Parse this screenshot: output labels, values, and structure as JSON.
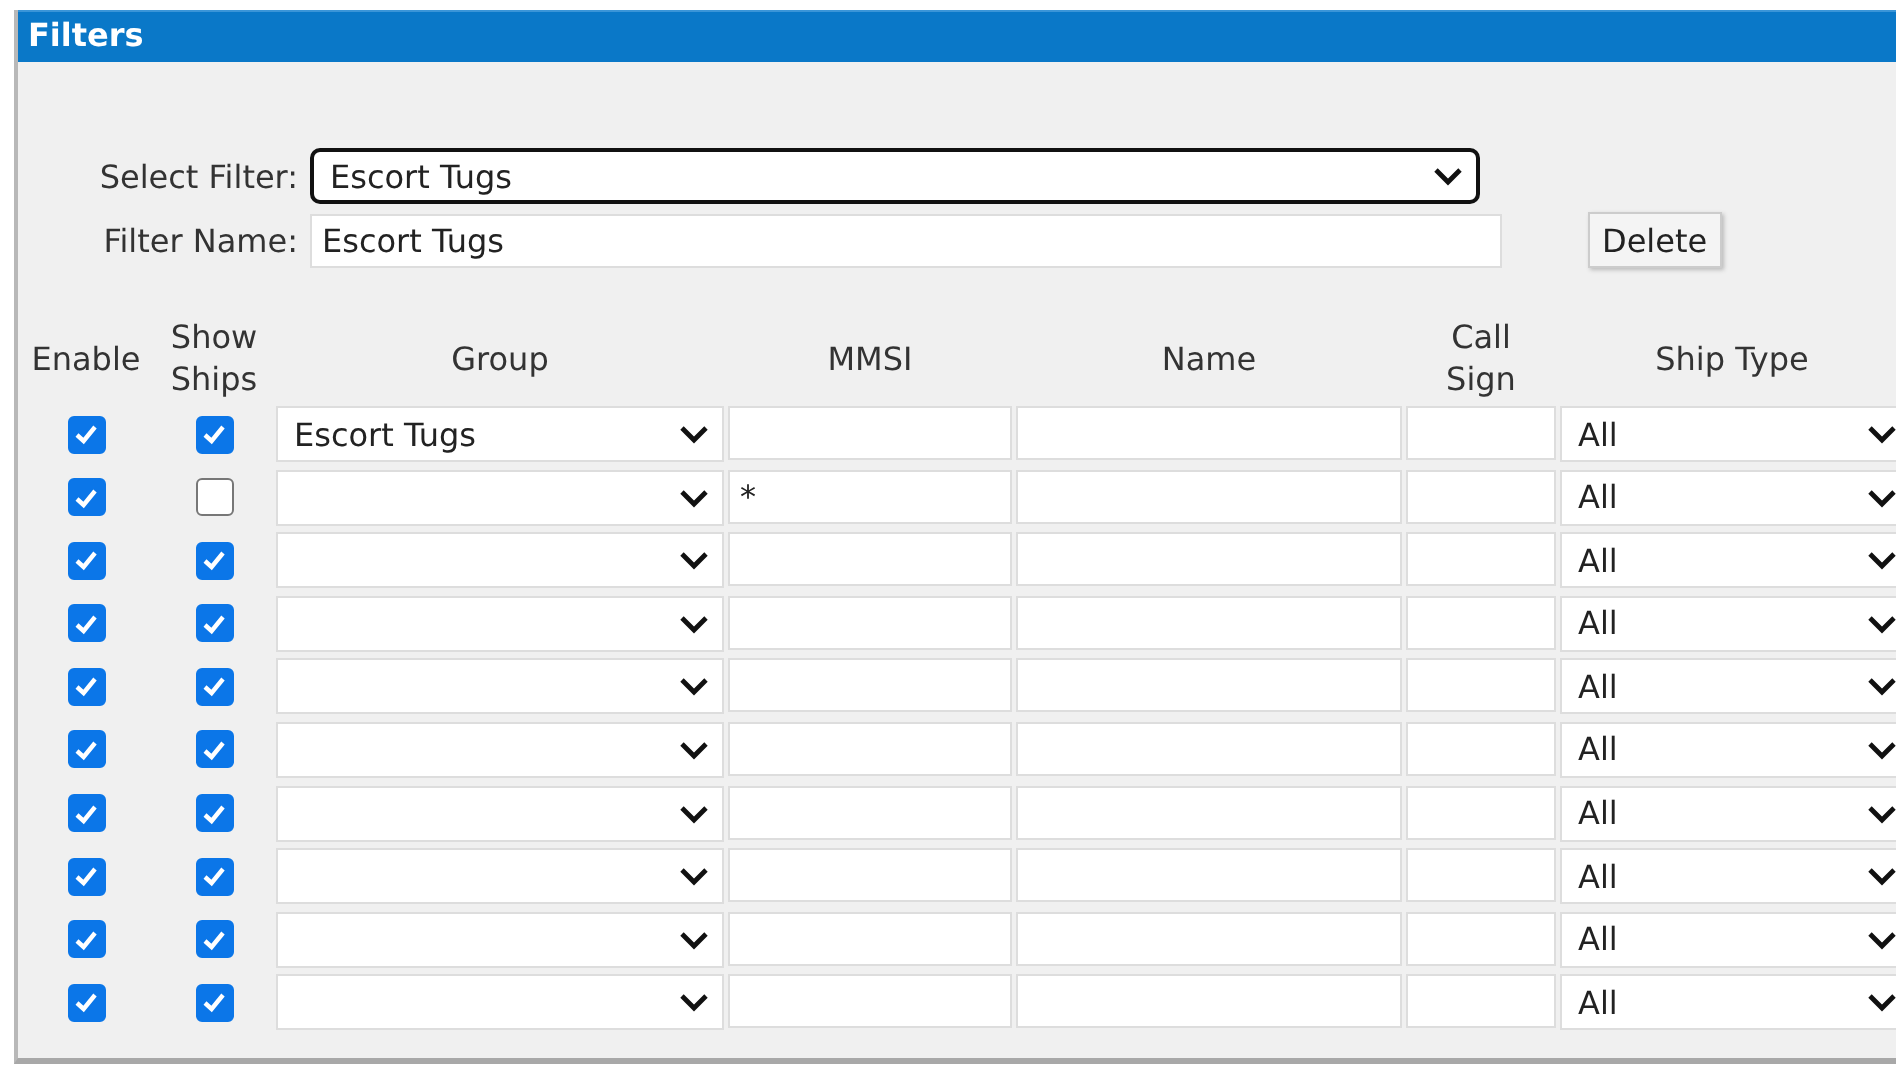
{
  "panel": {
    "title": "Filters"
  },
  "select_filter": {
    "label": "Select Filter:",
    "value": "Escort Tugs",
    "focused": true
  },
  "filter_name": {
    "label": "Filter Name:",
    "value": "Escort Tugs"
  },
  "delete_button": "Delete",
  "table": {
    "columns": [
      "Enable",
      "Show Ships",
      "Group",
      "MMSI",
      "Name",
      "Call Sign",
      "Ship Type"
    ],
    "rows": [
      {
        "enable": true,
        "show_ships": true,
        "group": "Escort Tugs",
        "ship_type": "All"
      },
      {
        "enable": true,
        "show_ships": false,
        "mmsi": "*",
        "ship_type": "All"
      },
      {
        "enable": true,
        "show_ships": true,
        "ship_type": "All"
      },
      {
        "enable": true,
        "show_ships": true,
        "ship_type": "All"
      },
      {
        "enable": true,
        "show_ships": true,
        "ship_type": "All"
      },
      {
        "enable": true,
        "show_ships": true,
        "ship_type": "All"
      },
      {
        "enable": true,
        "show_ships": true,
        "ship_type": "All"
      },
      {
        "enable": true,
        "show_ships": true,
        "ship_type": "All"
      },
      {
        "enable": true,
        "show_ships": true,
        "ship_type": "All"
      },
      {
        "enable": true,
        "show_ships": true,
        "ship_type": "All"
      }
    ]
  }
}
